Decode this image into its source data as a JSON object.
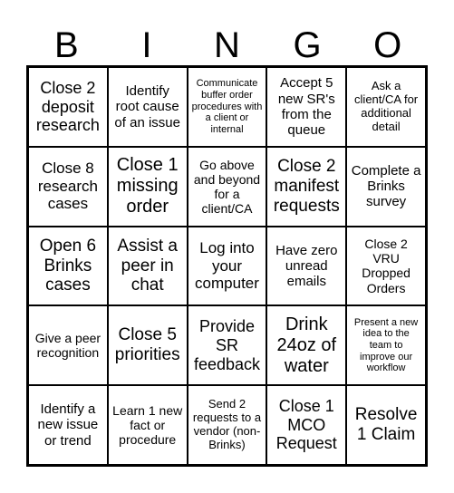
{
  "header": [
    "B",
    "I",
    "N",
    "G",
    "O"
  ],
  "cells": [
    "Close 2 deposit research",
    "Identify root cause of an issue",
    "Communicate buffer order procedures with a client or internal",
    "Accept 5 new SR's from the queue",
    "Ask a client/CA for additional detail",
    "Close 8 research cases",
    "Close 1 missing order",
    "Go above and beyond for a client/CA",
    "Close 2 manifest requests",
    "Complete a Brinks survey",
    "Open 6 Brinks cases",
    "Assist a peer in chat",
    "Log into your computer",
    "Have zero unread emails",
    "Close 2 VRU Dropped Orders",
    "Give a peer recognition",
    "Close 5 priorities",
    "Provide SR feedback",
    "Drink 24oz of water",
    "Present a new idea to the team to improve our workflow",
    "Identify a new issue or trend",
    "Learn 1 new fact or procedure",
    "Send 2 requests to a vendor (non-Brinks)",
    "Close 1 MCO Request",
    "Resolve 1 Claim"
  ]
}
